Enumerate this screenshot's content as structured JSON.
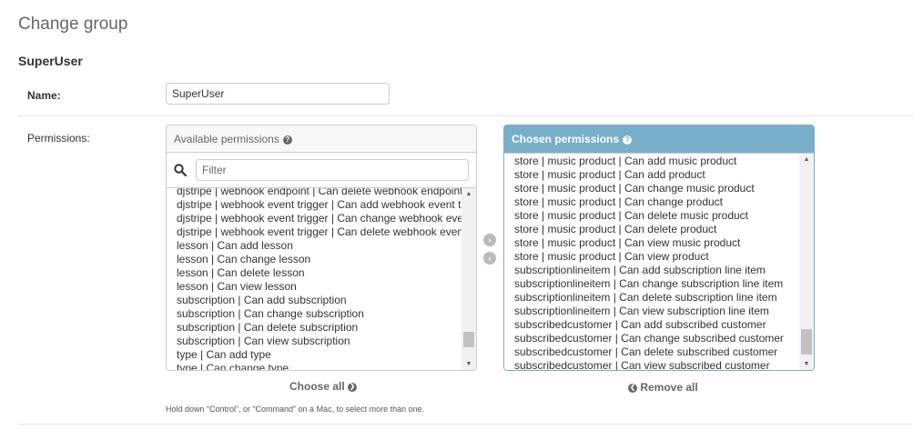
{
  "page": {
    "title": "Change group"
  },
  "fieldset": {
    "title": "SuperUser"
  },
  "name_field": {
    "label": "Name:",
    "value": "SuperUser"
  },
  "permissions": {
    "label": "Permissions:",
    "available": {
      "title": "Available permissions",
      "filter_placeholder": "Filter",
      "items": [
        "djstripe | webhook endpoint | Can delete webhook endpoint",
        "djstripe | webhook event trigger | Can add webhook event trigger",
        "djstripe | webhook event trigger | Can change webhook event trigger",
        "djstripe | webhook event trigger | Can delete webhook event trigger",
        "lesson | Can add lesson",
        "lesson | Can change lesson",
        "lesson | Can delete lesson",
        "lesson | Can view lesson",
        "subscription | Can add subscription",
        "subscription | Can change subscription",
        "subscription | Can delete subscription",
        "subscription | Can view subscription",
        "type | Can add type",
        "type | Can change type"
      ],
      "scroll_position": 0.92
    },
    "chosen": {
      "title": "Chosen permissions",
      "items": [
        "store | music product | Can add music product",
        "store | music product | Can add product",
        "store | music product | Can change music product",
        "store | music product | Can change product",
        "store | music product | Can delete music product",
        "store | music product | Can delete product",
        "store | music product | Can view music product",
        "store | music product | Can view product",
        "subscriptionlineitem | Can add subscription line item",
        "subscriptionlineitem | Can change subscription line item",
        "subscriptionlineitem | Can delete subscription line item",
        "subscriptionlineitem | Can view subscription line item",
        "subscribedcustomer | Can add subscribed customer",
        "subscribedcustomer | Can change subscribed customer",
        "subscribedcustomer | Can delete subscribed customer",
        "subscribedcustomer | Can view subscribed customer"
      ],
      "scroll_position": 0.98
    },
    "choose_all_label": "Choose all",
    "remove_all_label": "Remove all",
    "help_text": "Hold down “Control”, or “Command” on a Mac, to select more than one."
  },
  "icons": {
    "help": "question-circle-icon",
    "search": "magnifier-icon",
    "add": "arrow-right-circle-icon",
    "remove": "arrow-left-circle-icon",
    "choose_all": "chevron-right-circle-icon",
    "remove_all": "chevron-left-circle-icon"
  },
  "colors": {
    "chosen_header": "#79aec8",
    "available_header": "#f8f8f8",
    "border": "#cccccc"
  }
}
